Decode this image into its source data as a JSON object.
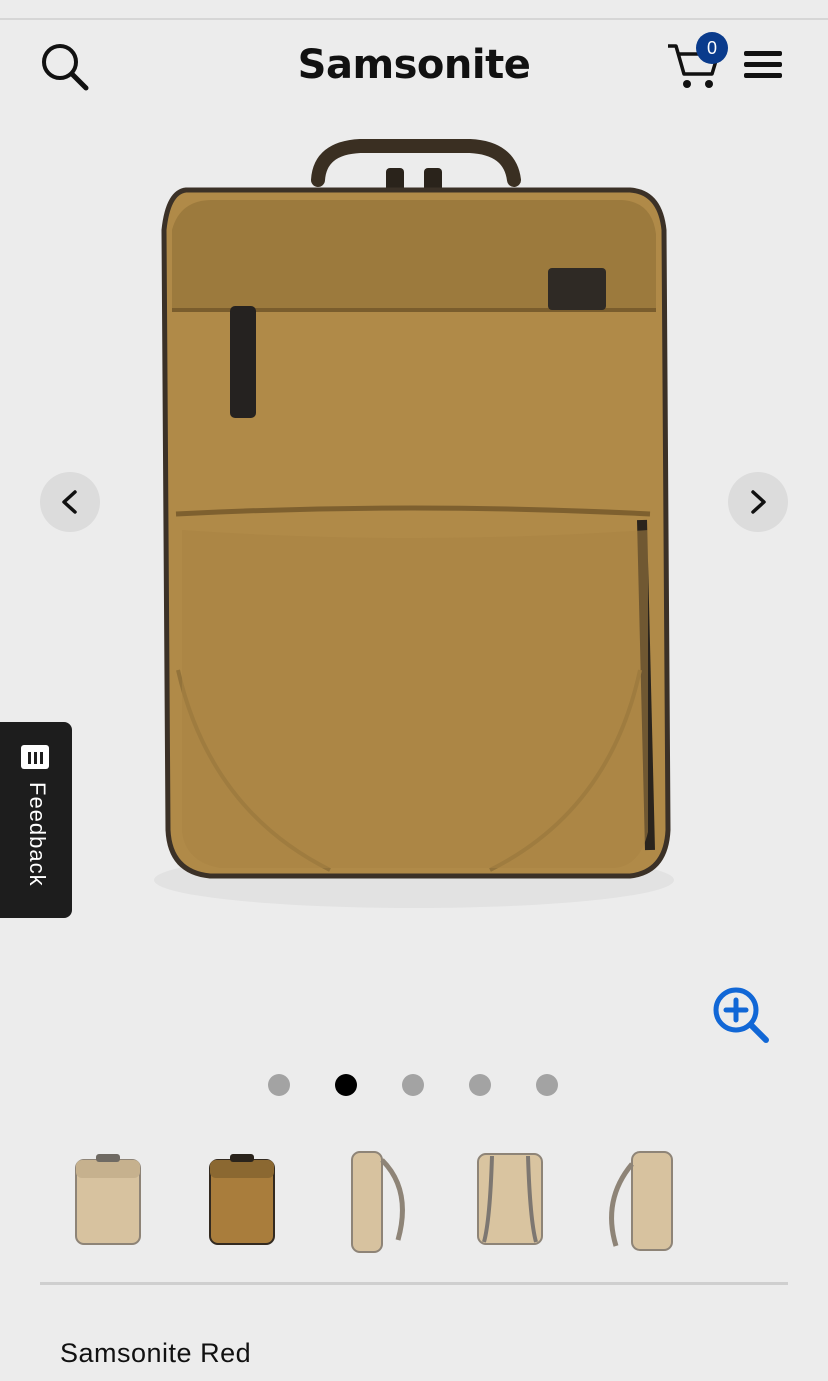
{
  "header": {
    "logo_text": "Samsonite",
    "cart_count": "0",
    "icons": {
      "search": "search-icon",
      "cart": "cart-icon",
      "menu": "hamburger-menu-icon"
    }
  },
  "gallery": {
    "active_index": 1,
    "slide_count": 5,
    "icons": {
      "prev": "chevron-left-icon",
      "next": "chevron-right-icon",
      "zoom": "zoom-in-icon"
    },
    "colors": {
      "main_bag": "#b08a48",
      "zoom_accent": "#1167d6"
    }
  },
  "thumbnails": [
    {
      "color": "beige"
    },
    {
      "color": "tan-brown"
    },
    {
      "color": "beige"
    },
    {
      "color": "beige"
    },
    {
      "color": "beige"
    }
  ],
  "feedback": {
    "label": "Feedback",
    "icon": "feedback-list-icon"
  },
  "product": {
    "brand": "Samsonite Red"
  }
}
